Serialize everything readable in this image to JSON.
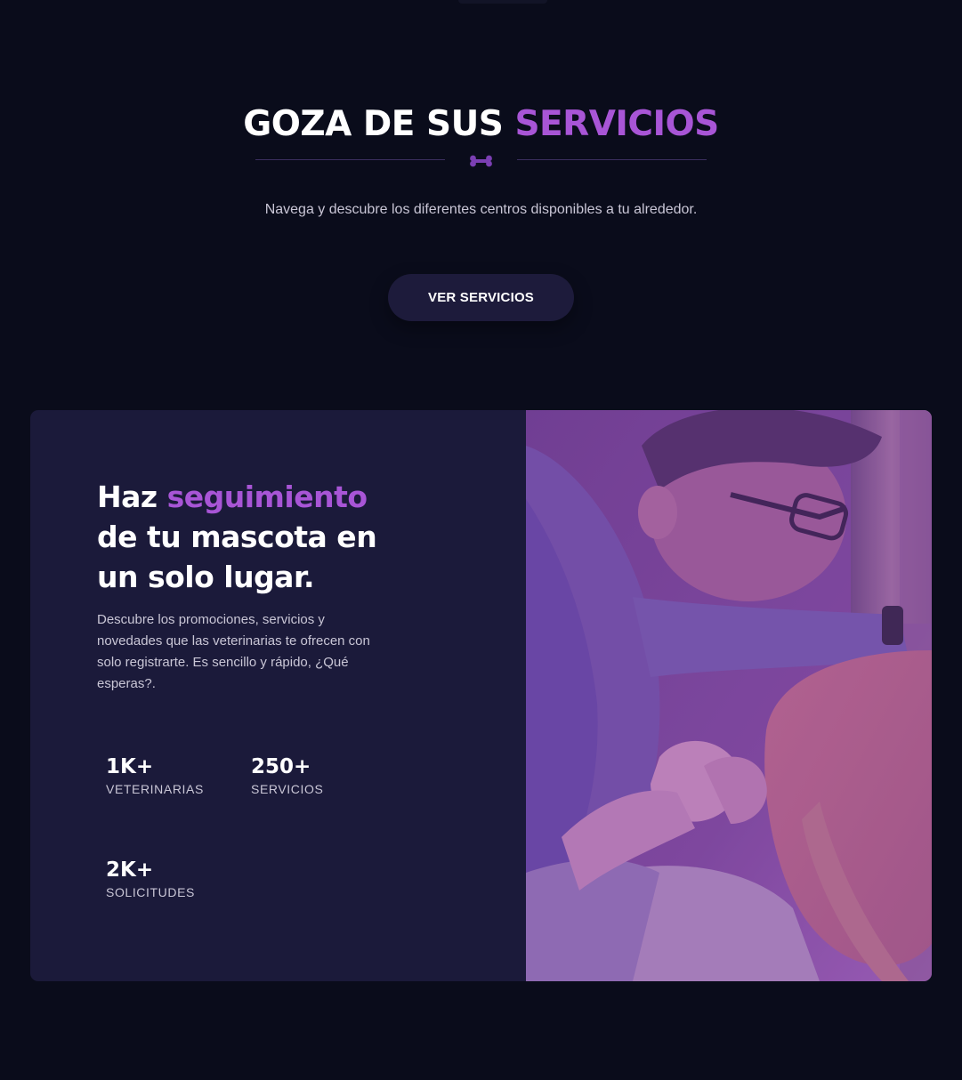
{
  "services": {
    "title_part1": "GOZA DE SUS ",
    "title_accent": "SERVICIOS",
    "description": "Navega y descubre los diferentes centros disponibles a tu alrededor.",
    "button_label": "VER SERVICIOS"
  },
  "tracking_card": {
    "heading_part1": "Haz ",
    "heading_accent": "seguimiento",
    "heading_part2": " de tu mascota en un solo lugar.",
    "description": "Descubre los promociones, servicios y novedades que las veterinarias te ofrecen con solo registrarte. Es sencillo y rápido, ¿Qué esperas?.",
    "stats": [
      {
        "value": "1K+",
        "label": "VETERINARIAS"
      },
      {
        "value": "250+",
        "label": "SERVICIOS"
      },
      {
        "value": "2K+",
        "label": "SOLICITUDES"
      }
    ]
  },
  "icons": {
    "divider": "bone-icon"
  },
  "colors": {
    "background": "#0a0c1b",
    "card": "#1b1a3a",
    "accent": "#a855d6",
    "button": "#1d1b3b"
  }
}
